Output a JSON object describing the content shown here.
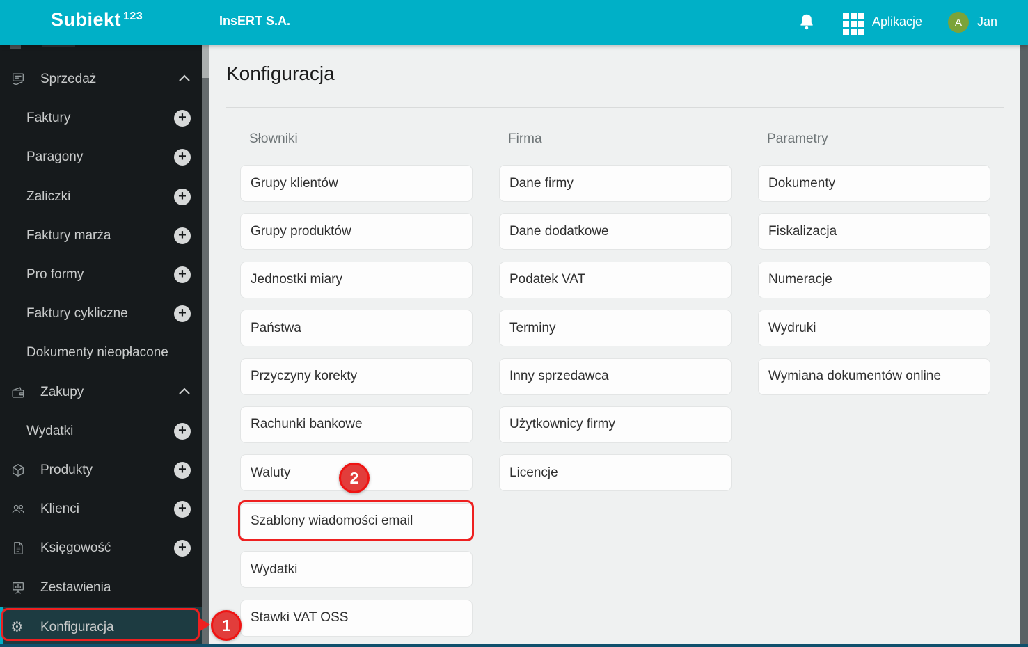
{
  "topbar": {
    "logo": "Subiekt",
    "logo_sup": "123",
    "company": "InsERT S.A.",
    "apps_label": "Aplikacje",
    "user_initial": "A",
    "user_name": "Jan"
  },
  "sidebar": {
    "items": [
      {
        "label": "Sprzedaż"
      },
      {
        "label": "Faktury"
      },
      {
        "label": "Paragony"
      },
      {
        "label": "Zaliczki"
      },
      {
        "label": "Faktury marża"
      },
      {
        "label": "Pro formy"
      },
      {
        "label": "Faktury cykliczne"
      },
      {
        "label": "Dokumenty nieopłacone"
      },
      {
        "label": "Zakupy"
      },
      {
        "label": "Wydatki"
      },
      {
        "label": "Produkty"
      },
      {
        "label": "Klienci"
      },
      {
        "label": "Księgowość"
      },
      {
        "label": "Zestawienia"
      },
      {
        "label": "Konfiguracja"
      }
    ]
  },
  "main": {
    "page_title": "Konfiguracja",
    "columns": [
      {
        "header": "Słowniki",
        "items": [
          "Grupy klientów",
          "Grupy produktów",
          "Jednostki miary",
          "Państwa",
          "Przyczyny korekty",
          "Rachunki bankowe",
          "Waluty",
          "Szablony wiadomości email",
          "Wydatki",
          "Stawki VAT OSS"
        ]
      },
      {
        "header": "Firma",
        "items": [
          "Dane firmy",
          "Dane dodatkowe",
          "Podatek VAT",
          "Terminy",
          "Inny sprzedawca",
          "Użytkownicy firmy",
          "Licencje"
        ]
      },
      {
        "header": "Parametry",
        "items": [
          "Dokumenty",
          "Fiskalizacja",
          "Numeracje",
          "Wydruki",
          "Wymiana dokumentów online"
        ]
      }
    ]
  },
  "annotations": {
    "step_1": "1",
    "step_2": "2",
    "highlighted_sidebar_item": "Konfiguracja",
    "highlighted_button": "Szablony wiadomości email"
  },
  "colors": {
    "topbar_teal": "#00b0c7",
    "annotation_red": "#ee2020",
    "avatar_green": "#7ba339",
    "active_item_bg": "#1d3b41"
  }
}
